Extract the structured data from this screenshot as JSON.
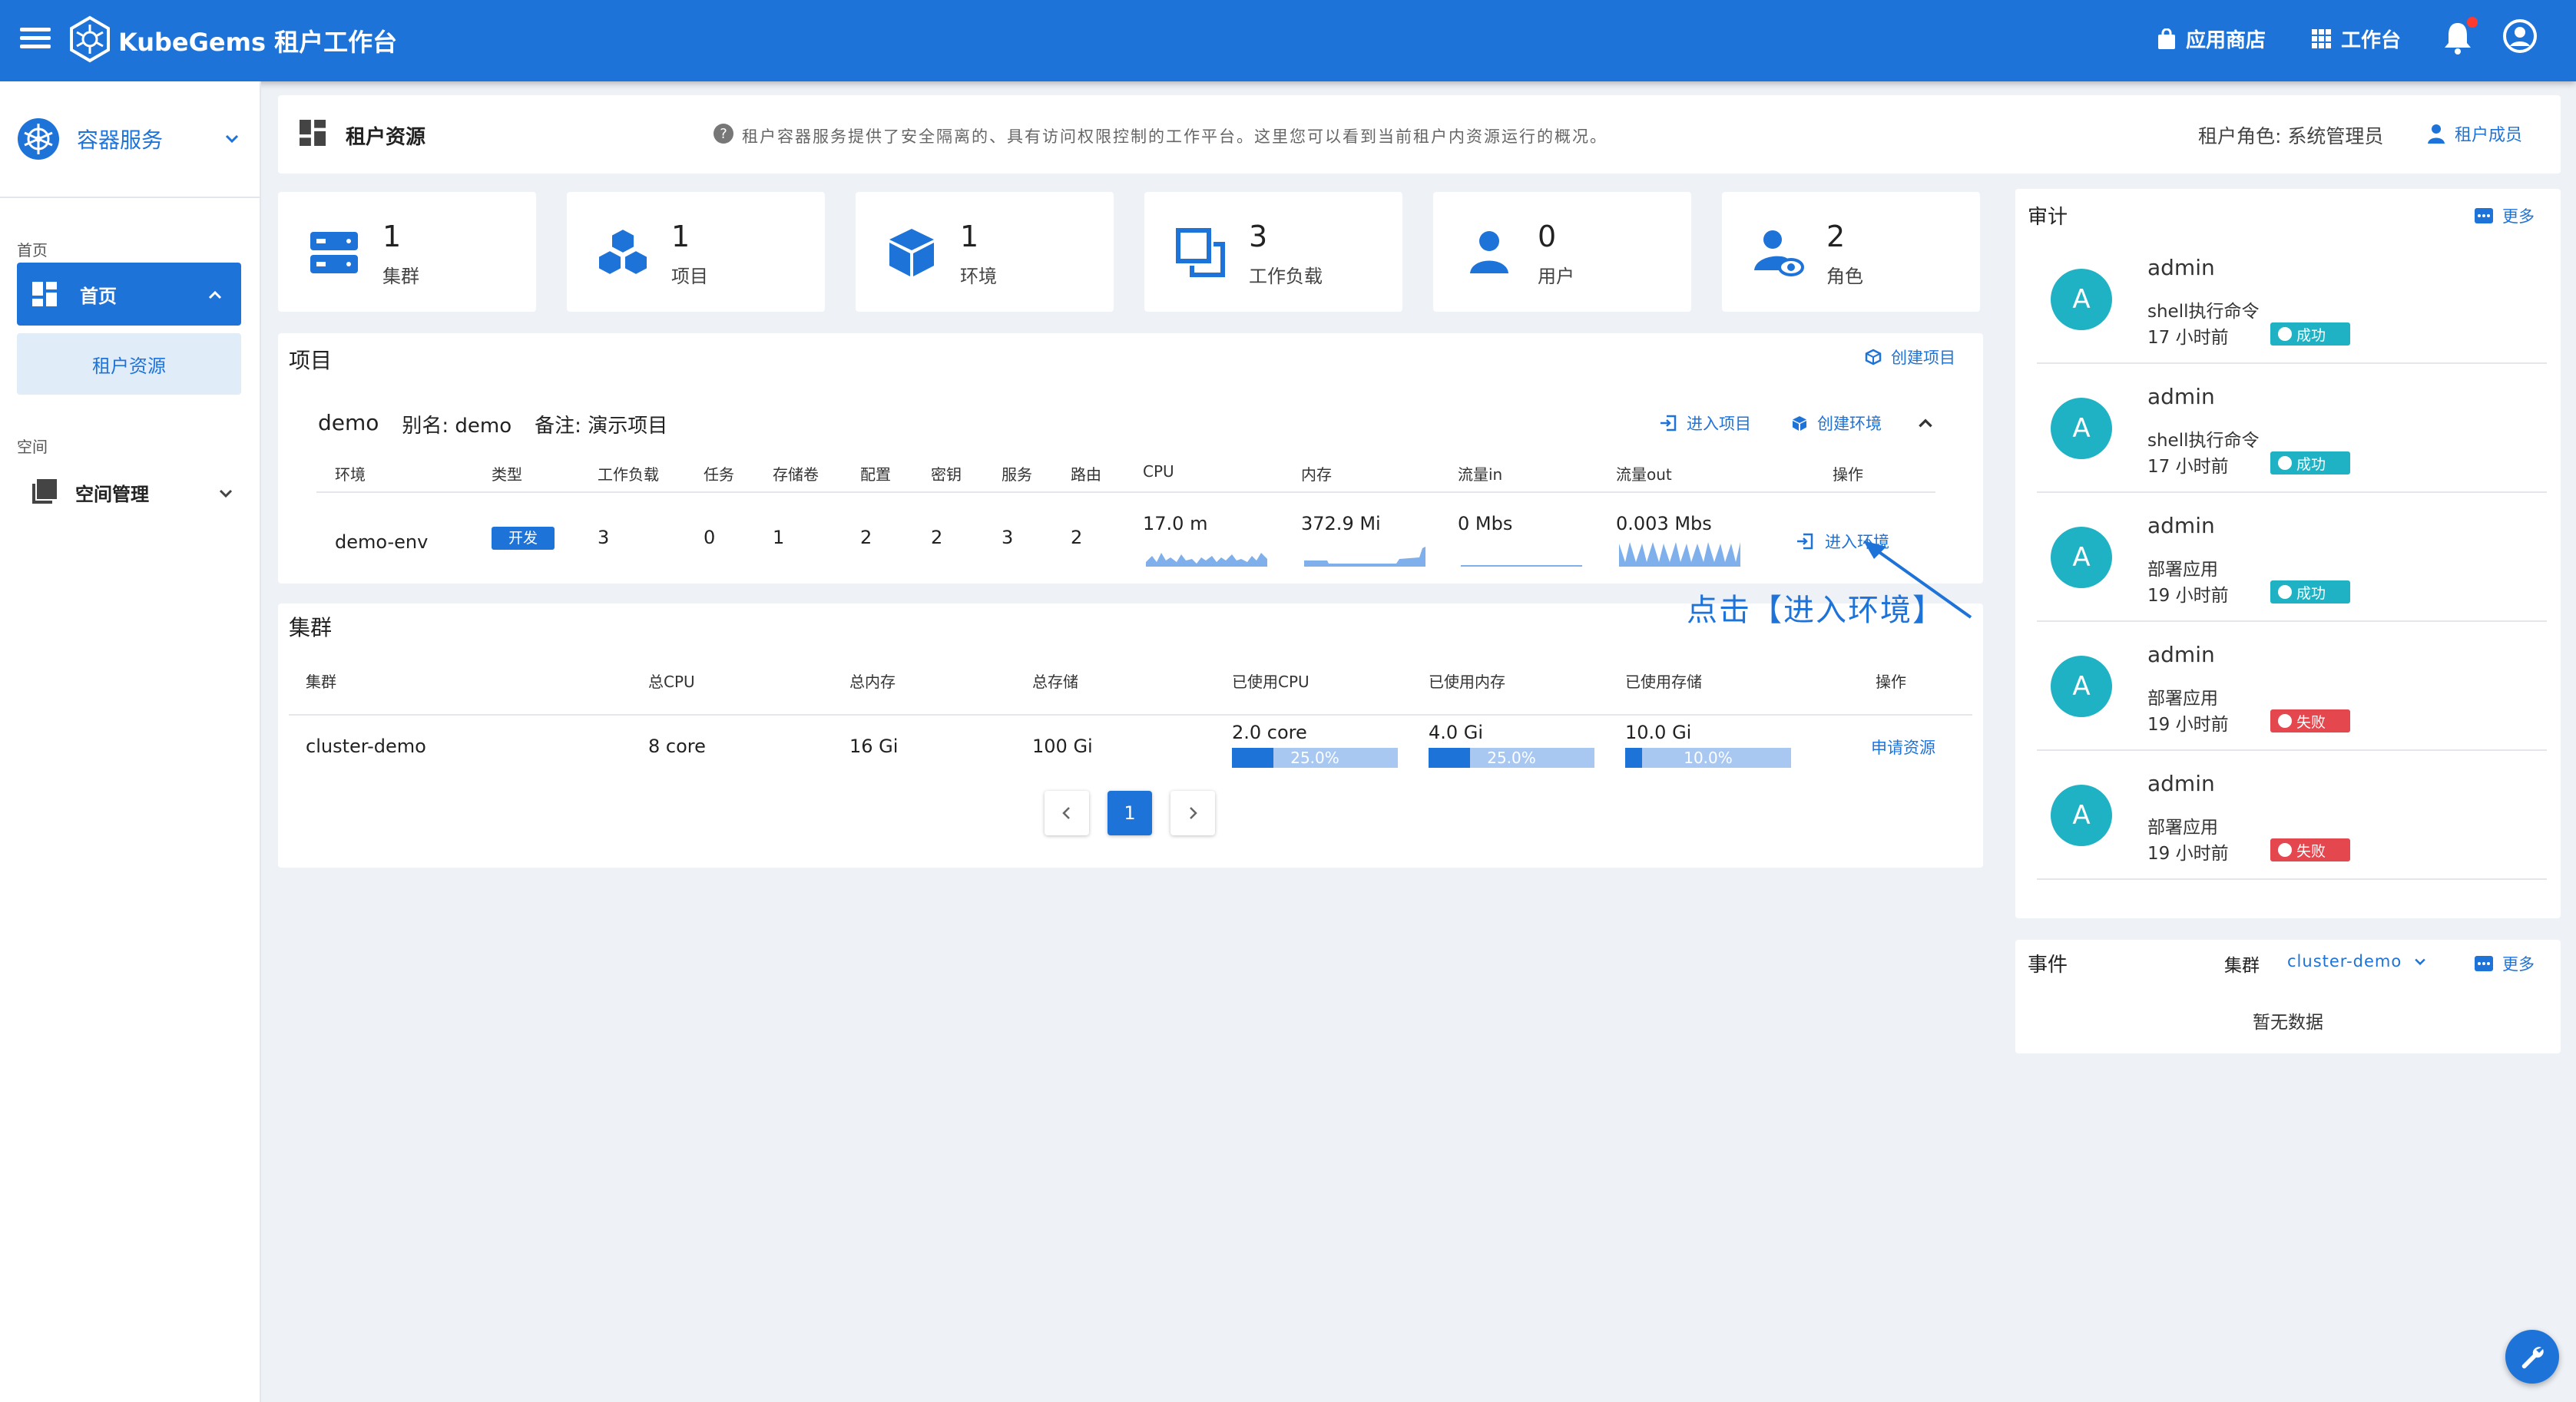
{
  "topbar": {
    "brand": "KubeGems 租户工作台",
    "app_store": "应用商店",
    "workbench": "工作台"
  },
  "sidebar": {
    "service": "容器服务",
    "section_home": "首页",
    "home": "首页",
    "tenant_resources": "租户资源",
    "section_space": "空间",
    "space_mgmt": "空间管理"
  },
  "header": {
    "title": "租户资源",
    "description": "租户容器服务提供了安全隔离的、具有访问权限控制的工作平台。这里您可以看到当前租户内资源运行的概况。",
    "role": "租户角色: 系统管理员",
    "members": "租户成员"
  },
  "stats": [
    {
      "num": "1",
      "label": "集群"
    },
    {
      "num": "1",
      "label": "项目"
    },
    {
      "num": "1",
      "label": "环境"
    },
    {
      "num": "3",
      "label": "工作负载"
    },
    {
      "num": "0",
      "label": "用户"
    },
    {
      "num": "2",
      "label": "角色"
    }
  ],
  "projects": {
    "title": "项目",
    "create": "创建项目",
    "name": "demo",
    "alias": "别名: demo",
    "note": "备注: 演示项目",
    "enter_project": "进入项目",
    "create_env": "创建环境",
    "columns": [
      "环境",
      "类型",
      "工作负载",
      "任务",
      "存储卷",
      "配置",
      "密钥",
      "服务",
      "路由",
      "CPU",
      "内存",
      "流量in",
      "流量out",
      "操作"
    ],
    "row": {
      "env": "demo-env",
      "type": "开发",
      "workloads": "3",
      "jobs": "0",
      "volumes": "1",
      "configs": "2",
      "secrets": "2",
      "services": "3",
      "routes": "2",
      "cpu": "17.0 m",
      "memory": "372.9 Mi",
      "in": "0 Mbs",
      "out": "0.003 Mbs",
      "action": "进入环境"
    }
  },
  "callout": "点击【进入环境】",
  "clusters": {
    "title": "集群",
    "columns": [
      "集群",
      "总CPU",
      "总内存",
      "总存储",
      "已使用CPU",
      "已使用内存",
      "已使用存储",
      "操作"
    ],
    "row": {
      "name": "cluster-demo",
      "cpu": "8 core",
      "memory": "16 Gi",
      "storage": "100 Gi",
      "used_cpu": "2.0 core",
      "used_cpu_pct": "25.0%",
      "used_mem": "4.0 Gi",
      "used_mem_pct": "25.0%",
      "used_storage": "10.0 Gi",
      "used_storage_pct": "10.0%",
      "action": "申请资源"
    },
    "usage_fractions": [
      0.25,
      0.25,
      0.1
    ],
    "page": "1"
  },
  "audit": {
    "title": "审计",
    "more": "更多",
    "items": [
      {
        "avatar": "A",
        "user": "admin",
        "action": "shell执行命令",
        "time": "17 小时前",
        "status": "成功"
      },
      {
        "avatar": "A",
        "user": "admin",
        "action": "shell执行命令",
        "time": "17 小时前",
        "status": "成功"
      },
      {
        "avatar": "A",
        "user": "admin",
        "action": "部署应用",
        "time": "19 小时前",
        "status": "成功"
      },
      {
        "avatar": "A",
        "user": "admin",
        "action": "部署应用",
        "time": "19 小时前",
        "status": "失败"
      },
      {
        "avatar": "A",
        "user": "admin",
        "action": "部署应用",
        "time": "19 小时前",
        "status": "失败"
      }
    ]
  },
  "events": {
    "title": "事件",
    "cluster_label": "集群",
    "cluster_value": "cluster-demo",
    "more": "更多",
    "empty": "暂无数据"
  },
  "colors": {
    "primary": "#1e73d9",
    "success": "#1fb2c5",
    "danger": "#e5474f"
  }
}
